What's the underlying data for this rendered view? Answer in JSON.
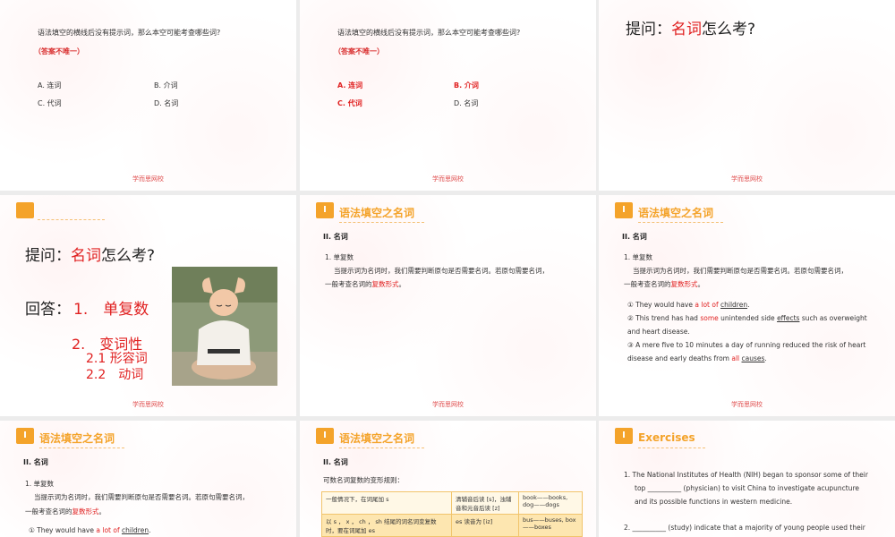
{
  "footer": "学而思网校",
  "slide1": {
    "question": "语法填空的横线后没有提示词，那么本空可能考查哪些词?",
    "note": "（答案不唯一）",
    "options": [
      "A. 连词",
      "B. 介词",
      "C. 代词",
      "D. 名词"
    ]
  },
  "slide2": {
    "question": "语法填空的横线后没有提示词，那么本空可能考查哪些词?",
    "note": "（答案不唯一）",
    "options": [
      "A. 连词",
      "B. 介词",
      "C. 代词",
      "D. 名词"
    ]
  },
  "slide3": {
    "q_prefix": "提问：",
    "q_red": "名词",
    "q_suffix": "怎么考?"
  },
  "slide4": {
    "q_prefix": "提问：",
    "q_red": "名词",
    "q_suffix": "怎么考?",
    "a_label": "回答：",
    "a1": "1.　单复数",
    "a2": "2.　变词性",
    "a21": "2.1 形容词",
    "a22": "2.2　动词"
  },
  "section": {
    "badge": "I",
    "title": "语法填空之名词",
    "heading": "II.  名词"
  },
  "singular_plural": {
    "item": "1.  单复数",
    "desc1": "当提示词为名词时，我们需要判断原句是否需要名词。若原句需要名词，",
    "desc2_prefix": "一般考查名词的",
    "desc2_red": "复数形式",
    "desc2_suffix": "。"
  },
  "examples": {
    "e1_pre": "① They would have ",
    "e1_red": "a lot of",
    "e1_space": " ",
    "e1_ul": "children",
    "e1_end": ".",
    "e2_pre": "② This trend has had ",
    "e2_red": "some",
    "e2_mid": " unintended side ",
    "e2_ul": "effects",
    "e2_end": " such as overweight",
    "e2_line2": "and heart disease.",
    "e3_line1": "③ A mere five to 10 minutes a day of running reduced the risk of heart",
    "e3_pre": "disease and early deaths from ",
    "e3_red": "all",
    "e3_space": " ",
    "e3_ul": "causes",
    "e3_end": "."
  },
  "slide8": {
    "intro": "可数名词复数的变形规则：",
    "rows": [
      [
        "一般情况下，在词尾加 s",
        "清辅音后读 [s]，浊辅音和元音后读 [z]",
        "book——books, dog——dogs"
      ],
      [
        "以 s ， x ， ch ， sh 结尾的词名词变复数时，要在词尾加 es",
        "es 读音为 [iz]",
        "bus——buses, box——boxes"
      ]
    ]
  },
  "slide9": {
    "title": "Exercises",
    "ex1_line1": "1.  The National Institutes of Health (NIH) began to sponsor some of their",
    "ex1_line2": "top __________ (physician) to visit China to investigate acupuncture",
    "ex1_line3": "and its possible functions in western medicine.",
    "ex2_line1": "2.  __________ (study) indicate that a majority of young people used their"
  }
}
